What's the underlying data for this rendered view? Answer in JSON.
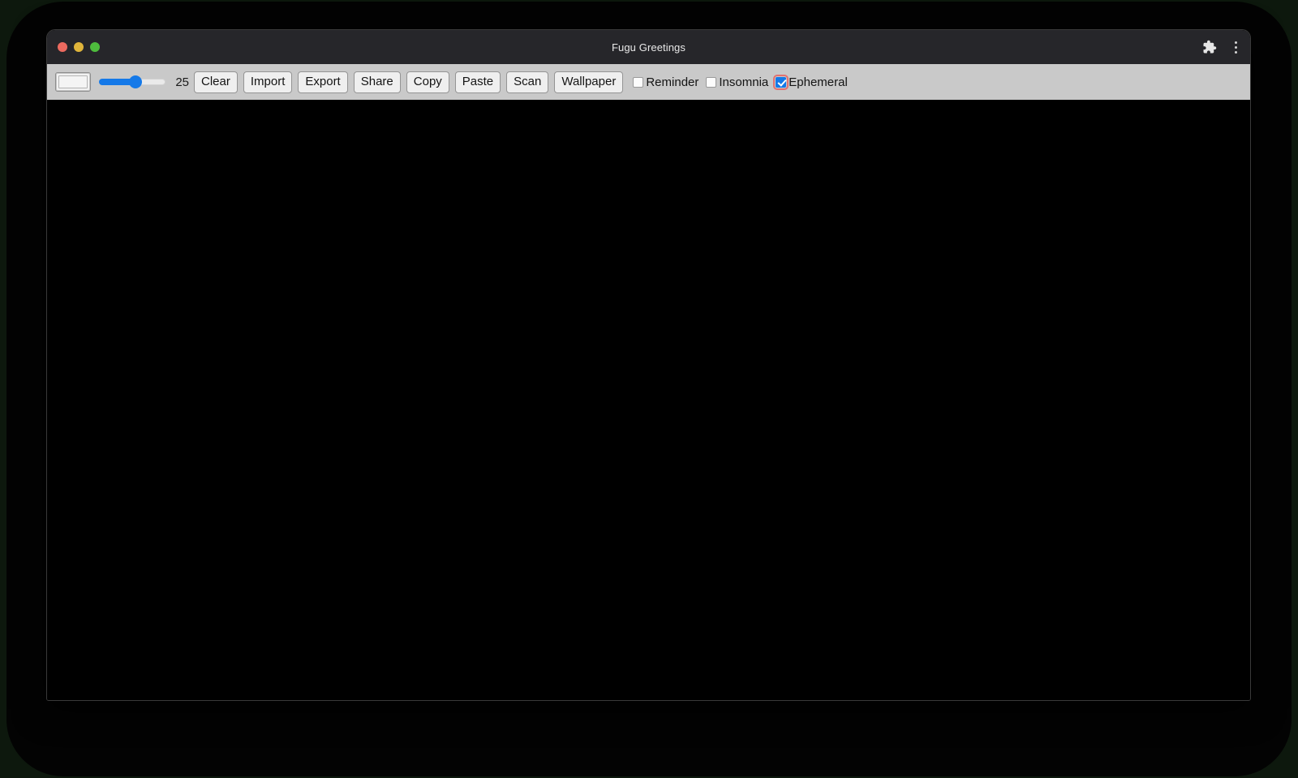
{
  "window": {
    "title": "Fugu Greetings",
    "traffic_lights": [
      {
        "name": "close",
        "color": "#ec6a5f"
      },
      {
        "name": "minimize",
        "color": "#e0b53b"
      },
      {
        "name": "maximize",
        "color": "#4ebc3d"
      }
    ],
    "actions": [
      {
        "name": "extensions-icon",
        "label": "Extensions"
      },
      {
        "name": "menu-icon",
        "label": "Customize and control"
      }
    ]
  },
  "toolbar": {
    "color_picker": {
      "label": "Color",
      "value": "#f4f4f4"
    },
    "line_width": {
      "label": "Line width",
      "value": "25",
      "min": "1",
      "max": "50"
    },
    "buttons": [
      {
        "name": "clear-button",
        "label": "Clear"
      },
      {
        "name": "import-button",
        "label": "Import"
      },
      {
        "name": "export-button",
        "label": "Export"
      },
      {
        "name": "share-button",
        "label": "Share"
      },
      {
        "name": "copy-button",
        "label": "Copy"
      },
      {
        "name": "paste-button",
        "label": "Paste"
      },
      {
        "name": "scan-button",
        "label": "Scan"
      },
      {
        "name": "wallpaper-button",
        "label": "Wallpaper"
      }
    ],
    "checkboxes": [
      {
        "name": "reminder-checkbox",
        "label": "Reminder",
        "checked": false,
        "focused": false
      },
      {
        "name": "insomnia-checkbox",
        "label": "Insomnia",
        "checked": false,
        "focused": false
      },
      {
        "name": "ephemeral-checkbox",
        "label": "Ephemeral",
        "checked": true,
        "focused": true
      }
    ]
  },
  "canvas": {
    "name": "drawing-canvas",
    "background": "#000000"
  },
  "colors": {
    "accent": "#1579e8",
    "toolbar_bg": "#c9c9c9",
    "titlebar_bg": "#26262a",
    "focus_ring": "#e2716f",
    "page_bg": "#0d180d"
  }
}
